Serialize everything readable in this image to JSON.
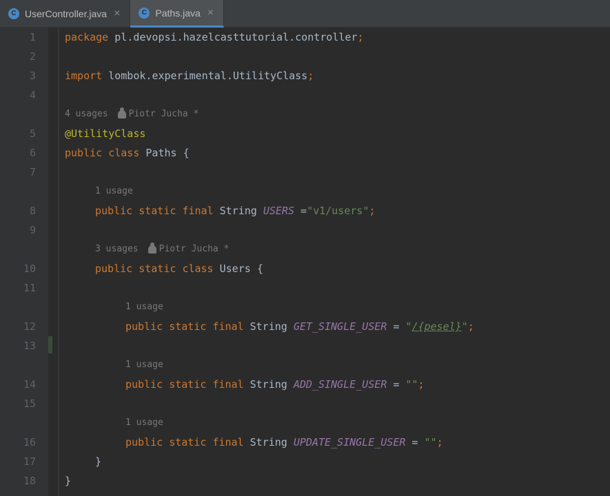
{
  "tabs": [
    {
      "label": "UserController.java",
      "active": false
    },
    {
      "label": "Paths.java",
      "active": true
    }
  ],
  "gutter_lines": [
    "1",
    "2",
    "3",
    "4",
    "",
    "5",
    "6",
    "7",
    "",
    "8",
    "9",
    "",
    "10",
    "11",
    "",
    "12",
    "13",
    "",
    "14",
    "15",
    "",
    "16",
    "17",
    "18"
  ],
  "inlay": {
    "class_usages": "4 usages",
    "class_author": "Piotr Jucha *",
    "users_const_usages": "1 usage",
    "inner_class_usages": "3 usages",
    "inner_class_author": "Piotr Jucha *",
    "get_usages": "1 usage",
    "add_usages": "1 usage",
    "update_usages": "1 usage"
  },
  "tokens": {
    "package": "package",
    "import": "import",
    "public": "public",
    "static": "static",
    "final": "final",
    "class": "class",
    "pkg_path": [
      "pl",
      ".",
      "devopsi",
      ".",
      "hazelcasttutorial",
      ".",
      "controller"
    ],
    "import_path": [
      "lombok",
      ".",
      "experimental",
      ".",
      "UtilityClass"
    ],
    "annotation": "@UtilityClass",
    "class_name": "Paths",
    "string_type": "String",
    "users_field": "USERS",
    "users_value": "\"v1/users\"",
    "inner_class_name": "Users",
    "get_field": "GET_SINGLE_USER",
    "get_value_q": "\"",
    "get_value_body": "/{pesel}",
    "add_field": "ADD_SINGLE_USER",
    "add_value": "\"\"",
    "update_field": "UPDATE_SINGLE_USER",
    "update_value": "\"\"",
    "semi": ";",
    "eq": " =",
    "brace_open": "{",
    "brace_close": "}"
  }
}
